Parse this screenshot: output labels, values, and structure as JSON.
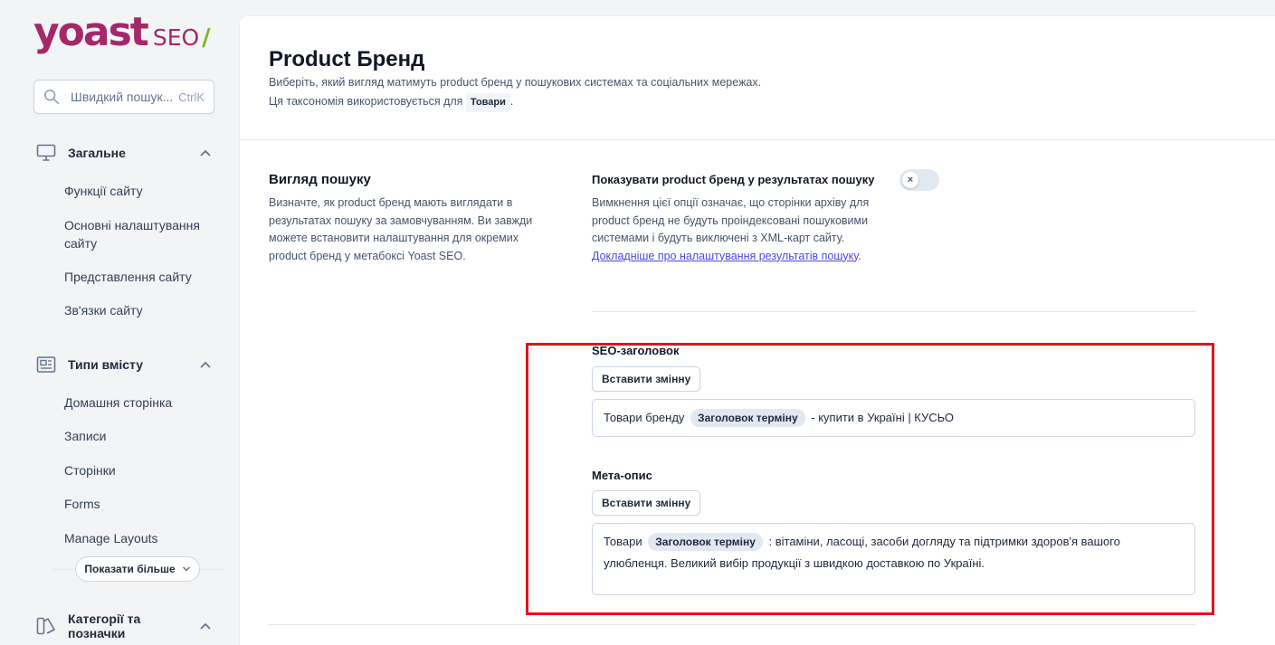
{
  "brand": {
    "logo_main": "yoast",
    "logo_seo": "SEO",
    "logo_slash": "/"
  },
  "search": {
    "placeholder": "Швидкий пошук...",
    "shortcut": "CtrlK"
  },
  "sidebar": {
    "groups": [
      {
        "title": "Загальне",
        "icon": "monitor-icon",
        "items": [
          "Функції сайту",
          "Основні налаштування сайту",
          "Представлення сайту",
          "Зв'язки сайту"
        ]
      },
      {
        "title": "Типи вмісту",
        "icon": "document-icon",
        "items": [
          "Домашня сторінка",
          "Записи",
          "Сторінки",
          "Forms",
          "Manage Layouts"
        ],
        "show_more": "Показати більше"
      },
      {
        "title": "Категорії та позначки",
        "icon": "tag-icon",
        "items": []
      }
    ]
  },
  "page": {
    "title": "Product Бренд",
    "desc_line1": "Виберіть, який вигляд матимуть product бренд у пошукових системах та соціальних мережах.",
    "desc_line2_prefix": "Ця таксономія використовується для",
    "desc_tag": "Товари",
    "desc_line2_suffix": "."
  },
  "section": {
    "title": "Вигляд пошуку",
    "desc": "Визначте, як product бренд мають виглядати в результатах пошуку за замовчуванням. Ви завжди можете встановити налаштування для окремих product бренд у метабоксі Yoast SEO."
  },
  "toggle_field": {
    "title": "Показувати product бренд у результатах пошуку",
    "desc": "Вимкнення цієї опції означає, що сторінки архіву для product бренд не будуть проіндексовані пошуковими системами і будуть виключені з XML-карт сайту.",
    "link": "Докладніше про налаштування результатів пошуку",
    "link_suffix": ".",
    "state": "off",
    "knob_glyph": "×"
  },
  "seo_title": {
    "label": "SEO-заголовок",
    "insert_button": "Вставити змінну",
    "text_before": "Товари бренду",
    "variable": "Заголовок терміну",
    "text_after": "- купити в Україні | КУСЬО"
  },
  "meta_desc": {
    "label": "Мета-опис",
    "insert_button": "Вставити змінну",
    "text_before": "Товари",
    "variable": "Заголовок терміну",
    "text_after": ": вітаміни, ласощі, засоби догляду та підтримки здоров'я вашого улюбленця. Великий вибір продукції з швидкою доставкою по Україні."
  },
  "colors": {
    "accent": "#a4286a",
    "highlight": "#e0141e",
    "link": "#4f46e5"
  }
}
